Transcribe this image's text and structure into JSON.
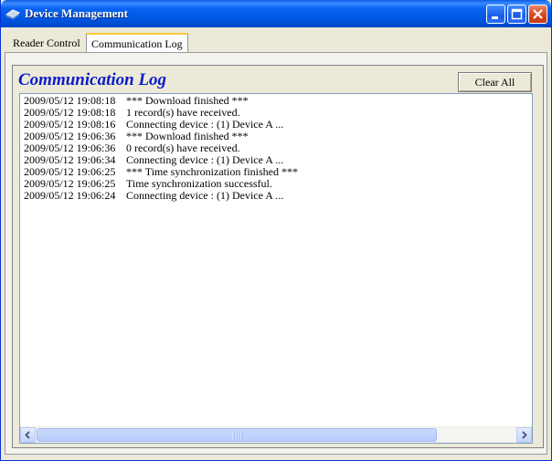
{
  "window": {
    "title": "Device Management",
    "icon": "app-icon",
    "controls": [
      "minimize-icon",
      "maximize-icon",
      "close-icon"
    ]
  },
  "tabs": [
    {
      "label": "Reader Control",
      "active": false
    },
    {
      "label": "Communication Log",
      "active": true
    }
  ],
  "panel": {
    "heading": "Communication Log",
    "heading_color": "#0A1CC8",
    "clear_button": "Clear All"
  },
  "log": [
    {
      "time": "2009/05/12 19:08:18",
      "message": "*** Download finished ***"
    },
    {
      "time": "2009/05/12 19:08:18",
      "message": "1 record(s) have received."
    },
    {
      "time": "2009/05/12 19:08:16",
      "message": "Connecting device : (1) Device A ..."
    },
    {
      "time": "2009/05/12 19:06:36",
      "message": "*** Download finished ***"
    },
    {
      "time": "2009/05/12 19:06:36",
      "message": "0 record(s) have received."
    },
    {
      "time": "2009/05/12 19:06:34",
      "message": "Connecting device : (1) Device A ..."
    },
    {
      "time": "2009/05/12 19:06:25",
      "message": "*** Time synchronization finished ***"
    },
    {
      "time": "2009/05/12 19:06:25",
      "message": "Time synchronization successful."
    },
    {
      "time": "2009/05/12 19:06:24",
      "message": "Connecting device : (1) Device A ..."
    }
  ]
}
